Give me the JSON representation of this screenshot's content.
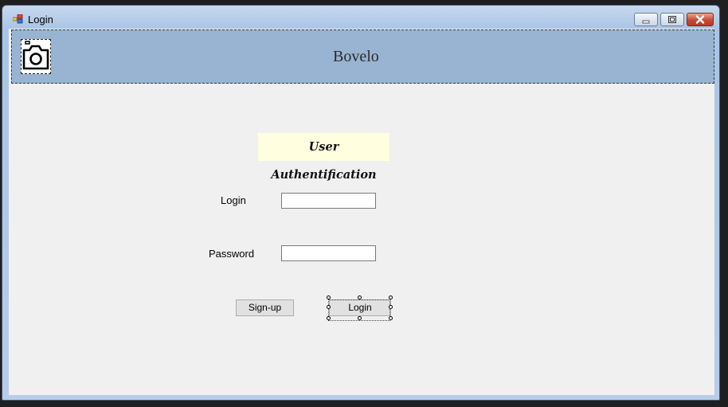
{
  "window": {
    "title": "Login",
    "icons": {
      "app": "form-icon",
      "minimize": "minimize-icon",
      "maximize": "maximize-icon",
      "close": "close-icon"
    }
  },
  "header": {
    "brand": "Bovelo",
    "logo_icon": "camera-icon",
    "background": "#98b4d2"
  },
  "form": {
    "title": "User Authentification",
    "title_background": "#ffffe0",
    "login_label": "Login",
    "login_value": "",
    "password_label": "Password",
    "password_value": "",
    "signup_button": "Sign-up",
    "login_button": "Login"
  }
}
